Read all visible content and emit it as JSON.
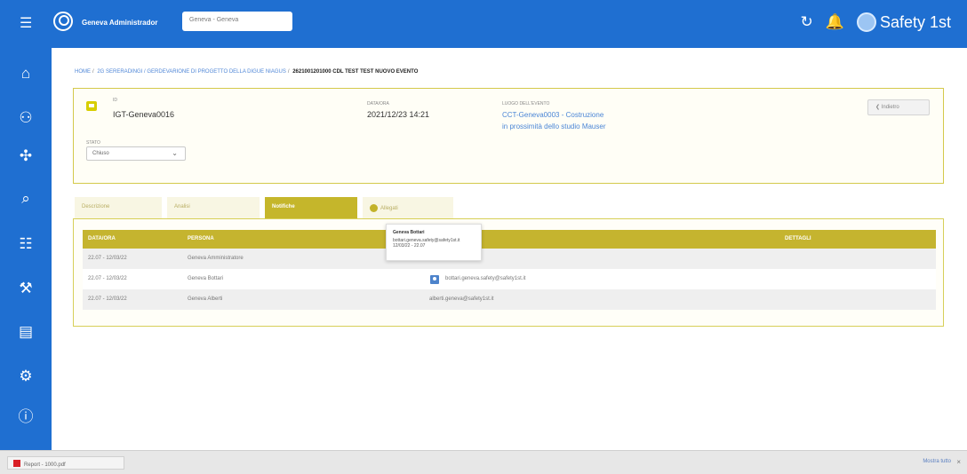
{
  "topbar": {
    "menu_icon": "menu-icon",
    "user_name": "Geneva Administrador",
    "company_select": "Geneva - Geneva",
    "brand_name": "Safety 1st"
  },
  "breadcrumb": {
    "home": "HOME",
    "section": "2G SERERADINGI / GERDEVARIONE DI PROGETTO DELLA DIGUE NIAGUS",
    "current": "2621001201000 CDL TEST TEST NUOVO EVENTO"
  },
  "event": {
    "id_label": "ID",
    "id_value": "IGT-Geneva0016",
    "status_label": "STATO",
    "status_value": "Chiuso",
    "date_label": "DATA/ORA",
    "date_value": "2021/12/23 14:21",
    "location_label": "LUOGO DELL'EVENTO",
    "location_line1": "CCT-Geneva0003 - Costruzione",
    "location_line2": "in prossimità dello studio Mauser",
    "back_label": "Indietro"
  },
  "tabs": [
    "Descrizione",
    "Analisi",
    "Notifiche",
    "Allegati"
  ],
  "table": {
    "headers": [
      "DATA/ORA",
      "PERSONA",
      "",
      "DETTAGLI"
    ],
    "rows": [
      {
        "date": "22.07 - 12/03/22",
        "person": "Geneva Amministratore",
        "detail": ""
      },
      {
        "date": "22.07 - 12/03/22",
        "person": "Geneva Bottari",
        "detail": "bottari.geneva.safety@safety1st.it"
      },
      {
        "date": "22.07 - 12/03/22",
        "person": "Geneva Alberti",
        "detail": "alberti.geneva@safety1st.it"
      }
    ]
  },
  "tooltip": {
    "title": "Geneva Bottari",
    "line1": "bottari.geneva.safety@safety1st.it",
    "line2": "12/03/22 - 22.07"
  },
  "download_bar": {
    "file": "Report - 1000.pdf",
    "show_all": "Mostra tutto"
  }
}
